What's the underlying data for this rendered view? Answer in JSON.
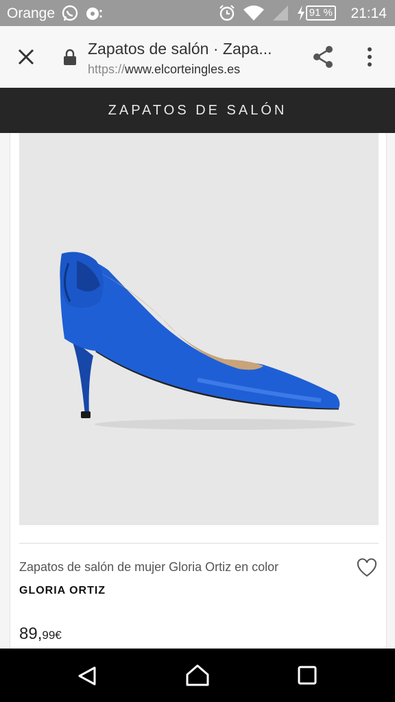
{
  "status_bar": {
    "carrier": "Orange",
    "battery": "91 %",
    "time": "21:14",
    "icons": [
      "whatsapp-icon",
      "record-icon",
      "alarm-icon",
      "wifi-icon",
      "signal-icon",
      "charging-icon",
      "battery-icon"
    ]
  },
  "browser": {
    "page_title": "Zapatos de salón · Zapa...",
    "url_scheme": "https://",
    "url_host": "www.elcorteingles.es",
    "icons": [
      "close-icon",
      "lock-icon",
      "share-icon",
      "more-vert-icon"
    ]
  },
  "section_header": {
    "title": "ZAPATOS DE SALÓN"
  },
  "product": {
    "image_icon": "blue-satin-pump-image",
    "name": "Zapatos de salón de mujer Gloria Ortiz en color",
    "brand": "GLORIA ORTIZ",
    "price_int": "89,",
    "price_dec": "99€",
    "favorite_icon": "heart-outline-icon"
  },
  "colors": {
    "status_bar": "#9a9a9a",
    "header_bar": "#262626",
    "shoe_blue": "#1f5fd6",
    "image_bg": "#e7e7e7"
  },
  "nav_bar": {
    "icons": [
      "back-icon",
      "home-icon",
      "recents-icon"
    ]
  }
}
